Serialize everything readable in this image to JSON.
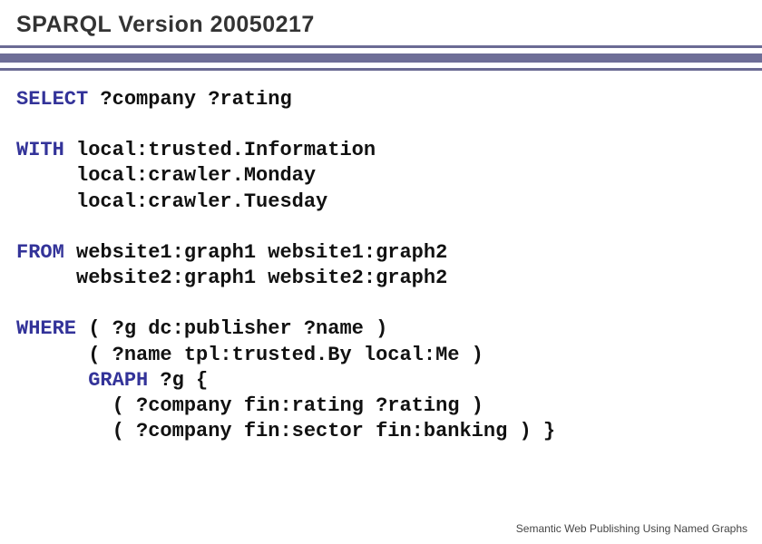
{
  "header": {
    "title": "SPARQL Version 20050217"
  },
  "code": {
    "kw_select": "SELECT",
    "select_rest": " ?company ?rating",
    "kw_with": "WITH",
    "with_1": " local:trusted.Information",
    "with_2": "     local:crawler.Monday",
    "with_3": "     local:crawler.Tuesday",
    "kw_from": "FROM",
    "from_1": " website1:graph1 website1:graph2",
    "from_2": "     website2:graph1 website2:graph2",
    "kw_where": "WHERE",
    "where_1": " ( ?g dc:publisher ?name )",
    "where_2": "      ( ?name tpl:trusted.By local:Me )",
    "where_3_a": "      ",
    "kw_graph": "GRAPH",
    "where_3_b": " ?g {",
    "where_4": "        ( ?company fin:rating ?rating )",
    "where_5": "        ( ?company fin:sector fin:banking ) }"
  },
  "footer": {
    "text": "Semantic Web Publishing Using Named Graphs"
  }
}
